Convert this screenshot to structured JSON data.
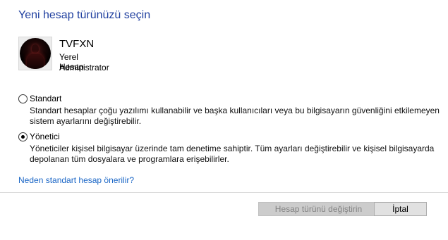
{
  "dialog": {
    "title": "Yeni hesap türünüzü seçin"
  },
  "user": {
    "name": "TVFXN",
    "line1": "Yerel Hesap",
    "line2": "Administrator"
  },
  "options": [
    {
      "label": "Standart",
      "checked": false,
      "description": "Standart hesaplar çoğu yazılımı kullanabilir ve başka kullanıcıları veya bu bilgisayarın güvenliğini etkilemeyen sistem ayarlarını değiştirebilir."
    },
    {
      "label": "Yönetici",
      "checked": true,
      "description": "Yöneticiler kişisel bilgisayar üzerinde tam denetime sahiptir. Tüm ayarları değiştirebilir ve kişisel bilgisayarda depolanan tüm dosyalara ve programlara erişebilirler."
    }
  ],
  "help_link": "Neden standart hesap önerilir?",
  "buttons": {
    "change": "Hesap türünü değiştirin",
    "cancel": "İptal"
  }
}
